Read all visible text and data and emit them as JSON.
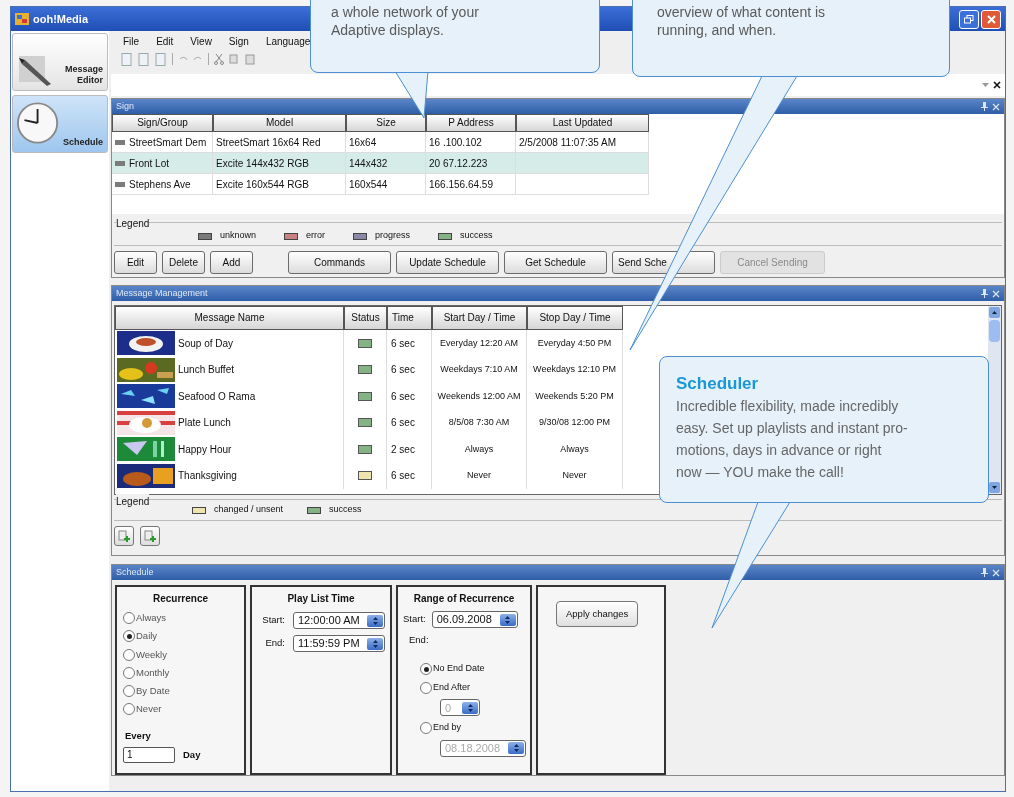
{
  "window": {
    "title": "ooh!Media"
  },
  "side_nav": [
    {
      "label": "Message Editor",
      "selected": false
    },
    {
      "label": "Schedule",
      "selected": true
    }
  ],
  "menu": [
    "File",
    "Edit",
    "View",
    "Sign",
    "Language"
  ],
  "sign_panel": {
    "title": "Sign",
    "columns": [
      "Sign/Group",
      "Model",
      "Size",
      "P Address",
      "Last Updated"
    ],
    "rows": [
      {
        "cells": [
          "StreetSmart Dem",
          "StreetSmart 16x64 Red",
          "16x64",
          "16 .100.102",
          "2/5/2008 11:07:35 AM"
        ],
        "selected": false
      },
      {
        "cells": [
          "Front Lot",
          "Excite 144x432 RGB",
          "144x432",
          "20 67.12.223",
          ""
        ],
        "selected": true
      },
      {
        "cells": [
          "Stephens Ave",
          "Excite 160x544 RGB",
          "160x544",
          "166.156.64.59",
          ""
        ],
        "selected": false
      }
    ],
    "legend": {
      "title": "Legend",
      "items": [
        {
          "label": "unknown",
          "color": "#7b7b7b"
        },
        {
          "label": "error",
          "color": "#c98282"
        },
        {
          "label": "progress",
          "color": "#8a8aa8"
        },
        {
          "label": "success",
          "color": "#86b386"
        }
      ]
    },
    "buttons": [
      {
        "label": "Edit",
        "disabled": false
      },
      {
        "label": "Delete",
        "disabled": false
      },
      {
        "label": "Add",
        "disabled": false
      },
      {
        "label": "Commands",
        "disabled": false
      },
      {
        "label": "Update Schedule",
        "disabled": false
      },
      {
        "label": "Get Schedule",
        "disabled": false
      },
      {
        "label": "Send Sche",
        "disabled": false
      },
      {
        "label": "Cancel Sending",
        "disabled": true
      }
    ]
  },
  "message_panel": {
    "title": "Message Management",
    "columns": [
      "Message Name",
      "Status",
      "Time",
      "Start Day / Time",
      "Stop Day / Time"
    ],
    "rows": [
      {
        "name": "Soup of Day",
        "color": "#86b386",
        "time": "6 sec",
        "start": "Everyday 12:20 AM",
        "stop": "Everyday 4:50 PM"
      },
      {
        "name": "Lunch Buffet",
        "color": "#86b386",
        "time": "6 sec",
        "start": "Weekdays 7:10 AM",
        "stop": "Weekdays 12:10 PM"
      },
      {
        "name": "Seafood O Rama",
        "color": "#86b386",
        "time": "6 sec",
        "start": "Weekends 12:00 AM",
        "stop": "Weekends 5:20 PM"
      },
      {
        "name": "Plate Lunch",
        "color": "#86b386",
        "time": "6 sec",
        "start": "8/5/08 7:30 AM",
        "stop": "9/30/08 12:00 PM"
      },
      {
        "name": "Happy Hour",
        "color": "#86b386",
        "time": "2 sec",
        "start": "Always",
        "stop": "Always"
      },
      {
        "name": "Thanksgiving",
        "color": "#ede4b0",
        "time": "6 sec",
        "start": "Never",
        "stop": "Never"
      }
    ],
    "legend": {
      "title": "Legend",
      "items": [
        {
          "label": "changed / unsent",
          "color": "#ede4b0"
        },
        {
          "label": "success",
          "color": "#86b386"
        }
      ]
    }
  },
  "schedule_panel": {
    "title": "Schedule",
    "recurrence": {
      "title": "Recurrence",
      "options": [
        {
          "label": "Always",
          "selected": false
        },
        {
          "label": "Daily",
          "selected": true
        },
        {
          "label": "Weekly",
          "selected": false
        },
        {
          "label": "Monthly",
          "selected": false
        },
        {
          "label": "By Date",
          "selected": false
        },
        {
          "label": "Never",
          "selected": false
        }
      ],
      "every_label": "Every",
      "every_value": "1",
      "unit": "Day"
    },
    "play_list_time": {
      "title": "Play List Time",
      "start_label": "Start:",
      "start": "12:00:00 AM",
      "end_label": "End:",
      "end": "11:59:59 PM"
    },
    "range": {
      "title": "Range of Recurrence",
      "start_label": "Start:",
      "start": "06.09.2008",
      "end_label": "End:",
      "options": [
        {
          "label": "No End Date",
          "selected": true
        },
        {
          "label": "End After",
          "selected": false
        },
        {
          "label": "End by",
          "selected": false
        }
      ],
      "end_after_value": "0",
      "end_by_value": "08.18.2008"
    },
    "apply_button": "Apply changes"
  },
  "callouts": [
    {
      "lines": [
        "a whole network of your",
        "Adaptive displays."
      ]
    },
    {
      "lines": [
        "overview of what content is",
        "running, and when."
      ]
    },
    {
      "title": "Scheduler",
      "lines": [
        "Incredible flexibility, made incredibly",
        "easy. Set up playlists and instant pro-",
        "motions, days in advance or right",
        "now — YOU make the call!"
      ]
    }
  ]
}
